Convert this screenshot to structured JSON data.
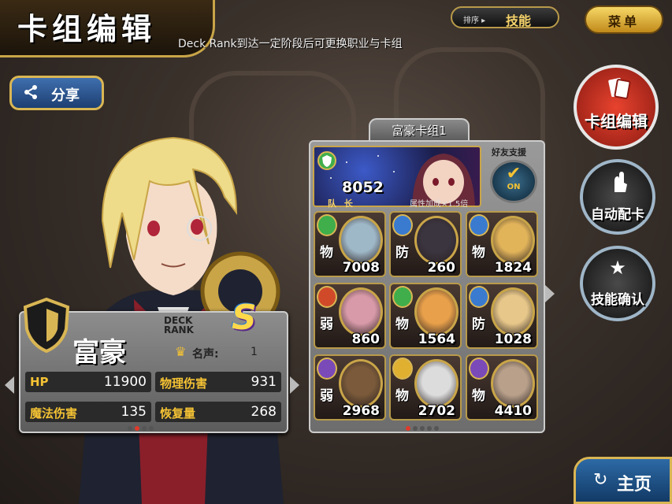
{
  "header": {
    "title": "卡组编辑",
    "hint": "Deck Rank到达一定阶段后可更换职业与卡组",
    "sort_label": "排序 ▸",
    "sort_value": "技能",
    "menu_label": "菜单"
  },
  "share": {
    "label": "分享",
    "icon": "share-icon"
  },
  "job": {
    "name": "富豪",
    "deck_rank_label": "DECK RANK",
    "rank": "S",
    "fame_label": "名声:",
    "fame_value": "1",
    "stats": [
      {
        "label": "HP",
        "value": "11900"
      },
      {
        "label": "物理伤害",
        "value": "931"
      },
      {
        "label": "魔法伤害",
        "value": "135"
      },
      {
        "label": "恢复量",
        "value": "268"
      }
    ],
    "page_count": 4,
    "page_active": 1
  },
  "deck": {
    "name": "富豪卡组1",
    "leader_power": "8052",
    "leader_tag": "队 长",
    "leader_bonus": "属性加成×1.5倍",
    "friend_label": "好友支援",
    "friend_status": "ON",
    "cards": [
      {
        "attr": "物",
        "power": "7008",
        "element": "#3fae4b",
        "face": "#9fb8c8"
      },
      {
        "attr": "防",
        "power": "260",
        "element": "#3a7bd0",
        "face": "#3b3540"
      },
      {
        "attr": "物",
        "power": "1824",
        "element": "#3a7bd0",
        "face": "#e2b45a"
      },
      {
        "attr": "弱",
        "power": "860",
        "element": "#d04a2a",
        "face": "#d89aa8"
      },
      {
        "attr": "物",
        "power": "1564",
        "element": "#3fae4b",
        "face": "#e8a04a"
      },
      {
        "attr": "防",
        "power": "1028",
        "element": "#3a7bd0",
        "face": "#e8c88a"
      },
      {
        "attr": "弱",
        "power": "2968",
        "element": "#7a4ab8",
        "face": "#7a5a3a"
      },
      {
        "attr": "物",
        "power": "2702",
        "element": "#e0b030",
        "face": "#dcdcdc"
      },
      {
        "attr": "物",
        "power": "4410",
        "element": "#7a4ab8",
        "face": "#b8a08a"
      }
    ],
    "page_count": 5,
    "page_active": 0
  },
  "side_buttons": [
    {
      "label": "卡组编辑",
      "active": true
    },
    {
      "label": "自动配卡",
      "active": false
    },
    {
      "label": "技能确认",
      "active": false
    }
  ],
  "home": {
    "label": "主页",
    "icon": "return-icon"
  },
  "colors": {
    "gold": "#c9a548",
    "hp": "#f4c234",
    "stat_label": "#f4c234",
    "active_red": "#c0281e"
  }
}
